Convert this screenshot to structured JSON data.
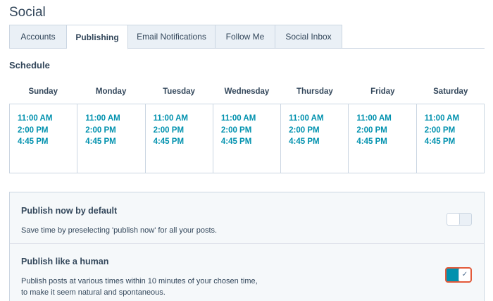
{
  "page": {
    "title": "Social"
  },
  "tabs": [
    {
      "label": "Accounts",
      "active": false
    },
    {
      "label": "Publishing",
      "active": true
    },
    {
      "label": "Email Notifications",
      "active": false
    },
    {
      "label": "Follow Me",
      "active": false
    },
    {
      "label": "Social Inbox",
      "active": false
    }
  ],
  "schedule": {
    "heading": "Schedule",
    "days": [
      {
        "name": "Sunday",
        "times": [
          "11:00 AM",
          "2:00 PM",
          "4:45 PM"
        ]
      },
      {
        "name": "Monday",
        "times": [
          "11:00 AM",
          "2:00 PM",
          "4:45 PM"
        ]
      },
      {
        "name": "Tuesday",
        "times": [
          "11:00 AM",
          "2:00 PM",
          "4:45 PM"
        ]
      },
      {
        "name": "Wednesday",
        "times": [
          "11:00 AM",
          "2:00 PM",
          "4:45 PM"
        ]
      },
      {
        "name": "Thursday",
        "times": [
          "11:00 AM",
          "2:00 PM",
          "4:45 PM"
        ]
      },
      {
        "name": "Friday",
        "times": [
          "11:00 AM",
          "2:00 PM",
          "4:45 PM"
        ]
      },
      {
        "name": "Saturday",
        "times": [
          "11:00 AM",
          "2:00 PM",
          "4:45 PM"
        ]
      }
    ]
  },
  "settings": {
    "publish_now": {
      "title": "Publish now by default",
      "description": "Save time by preselecting 'publish now' for all your posts.",
      "enabled": false
    },
    "publish_human": {
      "title": "Publish like a human",
      "description": "Publish posts at various times within 10 minutes of your chosen time, to make it seem natural and spontaneous.",
      "enabled": true,
      "check_icon": "✓"
    }
  },
  "colors": {
    "accent": "#0091ae",
    "text": "#33475b",
    "border": "#cbd6e2",
    "highlight": "#e35a3a"
  }
}
